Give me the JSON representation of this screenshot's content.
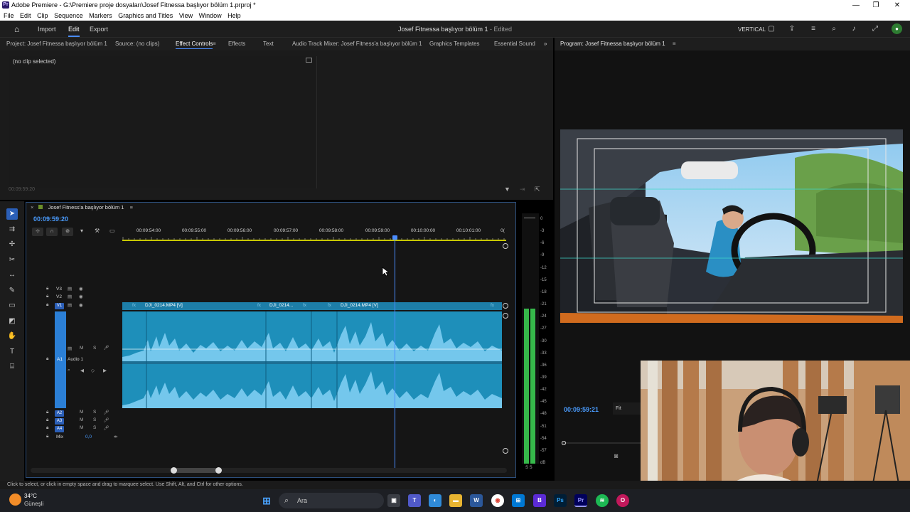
{
  "window": {
    "title": "Adobe Premiere - G:\\Premiere proje dosyaları\\Josef Fitnessa başlıyor bölüm 1.prproj *",
    "minimize": "—",
    "maximize": "❐",
    "close": "✕"
  },
  "menu": [
    "File",
    "Edit",
    "Clip",
    "Sequence",
    "Markers",
    "Graphics and Titles",
    "View",
    "Window",
    "Help"
  ],
  "header": {
    "modes": [
      "Import",
      "Edit",
      "Export"
    ],
    "active_mode": "Edit",
    "project_title": "Josef Fitnessa başlıyor bölüm 1",
    "status": "- Edited",
    "vertical_label": "VERTICAL"
  },
  "panel_tabs": [
    "Project: Josef Fitnessa başlıyor bölüm 1",
    "Source: (no clips)",
    "Effect Controls",
    "Effects",
    "Text",
    "Audio Track Mixer: Josef Fitness'a başlıyor bölüm 1",
    "Graphics Templates",
    "Essential Sound"
  ],
  "active_tab": "Effect Controls",
  "effect_controls": {
    "no_clip": "(no clip selected)",
    "timecode": "00:09:59:20"
  },
  "program": {
    "title": "Program: Josef Fitnessa başlıyor bölüm 1",
    "timecode": "00:09:59:21",
    "zoom": "Fit"
  },
  "timeline": {
    "sequence_name": "Josef Fitness'a başlıyor bölüm 1",
    "timecode": "00:09:59:20",
    "ruler": [
      "00:09:54:00",
      "00:09:55:00",
      "00:09:56:00",
      "00:09:57:00",
      "00:09:58:00",
      "00:09:59:00",
      "00:10:00:00",
      "00:10:01:00",
      "0("
    ],
    "tracks": {
      "v3": "V3",
      "v2": "V2",
      "v1": "V1",
      "a1": "A1",
      "a1_name": "Audio 1",
      "a2": "A2",
      "a3": "A3",
      "a4": "A4",
      "mix": "Mix",
      "mix_value": "0,0",
      "m": "M",
      "s": "S"
    },
    "clips": [
      {
        "label": "DJI_0214.MP4 [V]"
      },
      {
        "label": "DJI_0214..."
      },
      {
        "label": "DJI_0214.MP4 [V]"
      }
    ],
    "fx": "fx"
  },
  "vu_labels": [
    "0",
    "-3",
    "-6",
    "-9",
    "-12",
    "-15",
    "-18",
    "-21",
    "-24",
    "-27",
    "-30",
    "-33",
    "-36",
    "-39",
    "-42",
    "-45",
    "-48",
    "-51",
    "-54",
    "-57",
    "dB"
  ],
  "vu_level": 0.62,
  "vu_solo": "S S",
  "status_text": "Click to select, or click in empty space and drag to marquee select. Use Shift, Alt, and Ctrl for other options.",
  "taskbar": {
    "temp": "34°C",
    "condition": "Güneşli",
    "search": "Ara"
  }
}
